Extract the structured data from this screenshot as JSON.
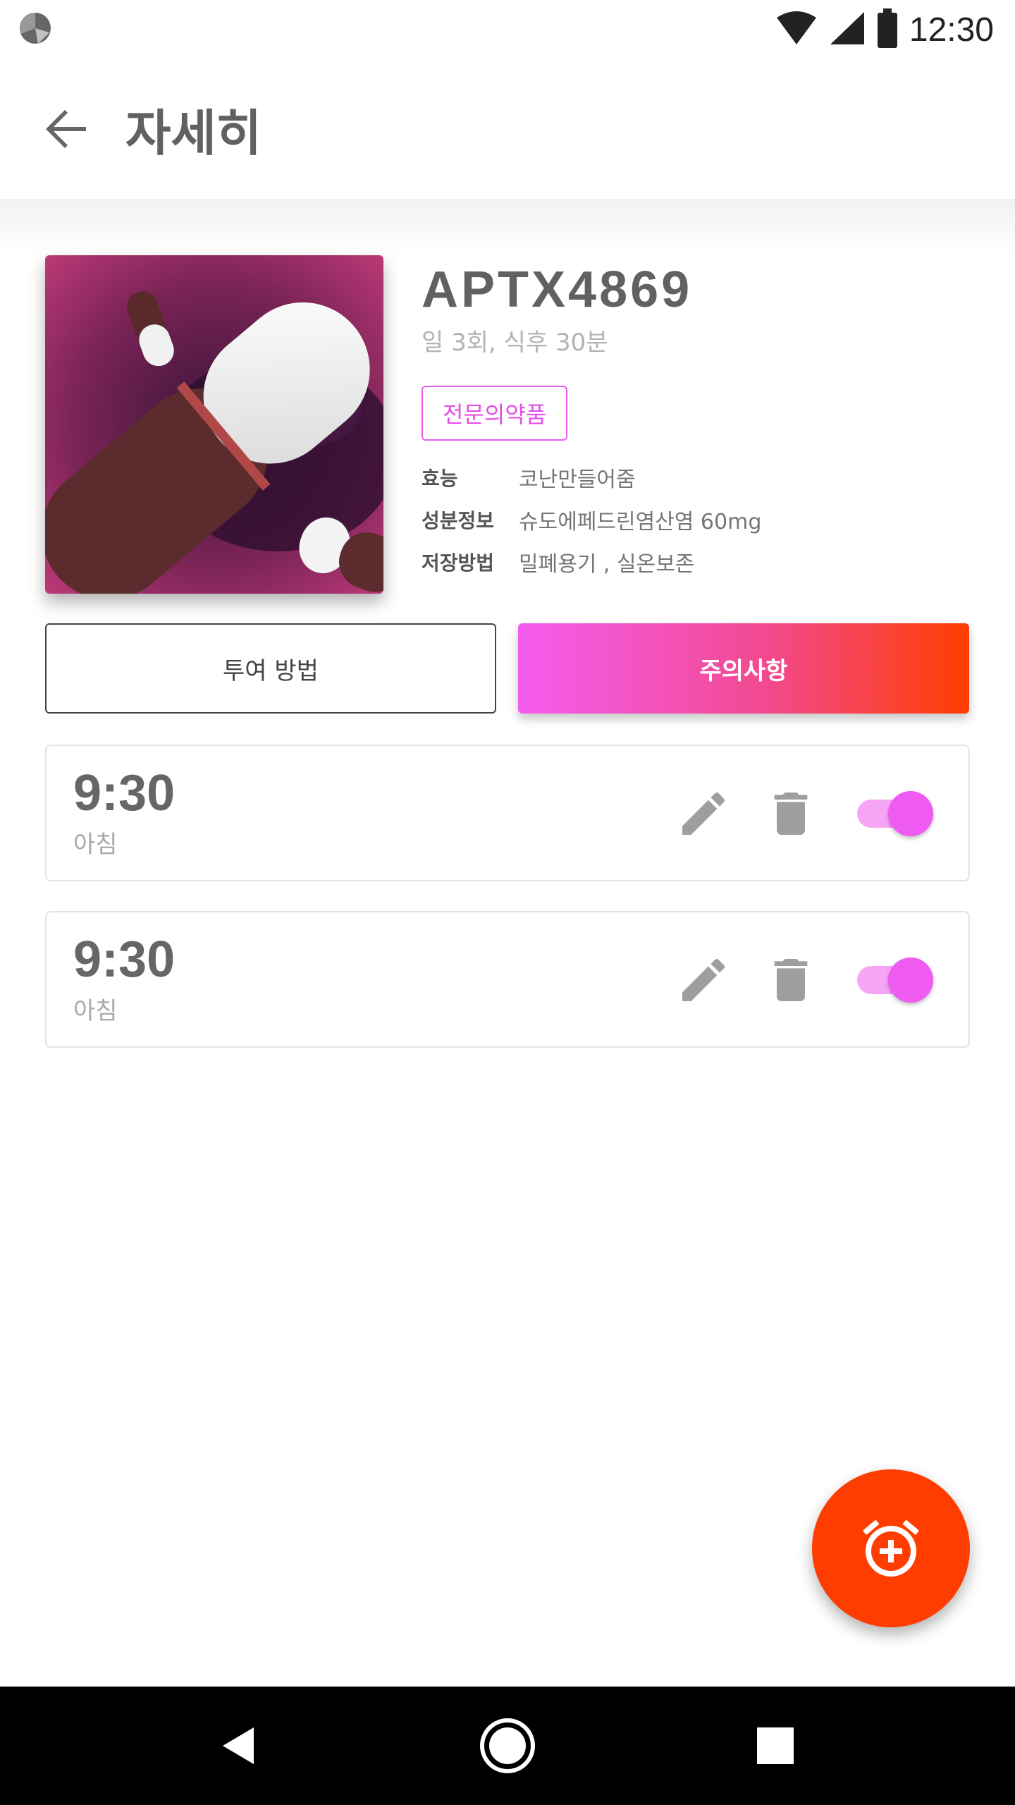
{
  "status_bar": {
    "time": "12:30",
    "icons": [
      "app-notification-icon",
      "wifi-icon",
      "cell-signal-icon",
      "battery-icon"
    ]
  },
  "app_bar": {
    "title": "자세히",
    "back_icon": "arrow-back-icon"
  },
  "product": {
    "name": "APTX4869",
    "dosage": "일 3회, 식후 30분",
    "badge": "전문의약품",
    "info": [
      {
        "key": "효능",
        "value": "코난만들어줌"
      },
      {
        "key": "성분정보",
        "value": "슈도에페드린염산염 60mg"
      },
      {
        "key": "저장방법",
        "value": "밀폐용기 , 실온보존"
      }
    ]
  },
  "buttons": {
    "dosage_method": "투여 방법",
    "precautions": "주의사항"
  },
  "alarms": [
    {
      "time": "9:30",
      "label": "아침",
      "enabled": true
    },
    {
      "time": "9:30",
      "label": "아침",
      "enabled": true
    }
  ],
  "fab": {
    "icon": "add-alarm-icon"
  },
  "colors": {
    "accent_pink": "#ee5af2",
    "accent_orange": "#ff3d00",
    "badge_border": "#e95cf0"
  },
  "nav": {
    "icons": [
      "back-triangle-icon",
      "home-circle-icon",
      "recents-square-icon"
    ]
  }
}
